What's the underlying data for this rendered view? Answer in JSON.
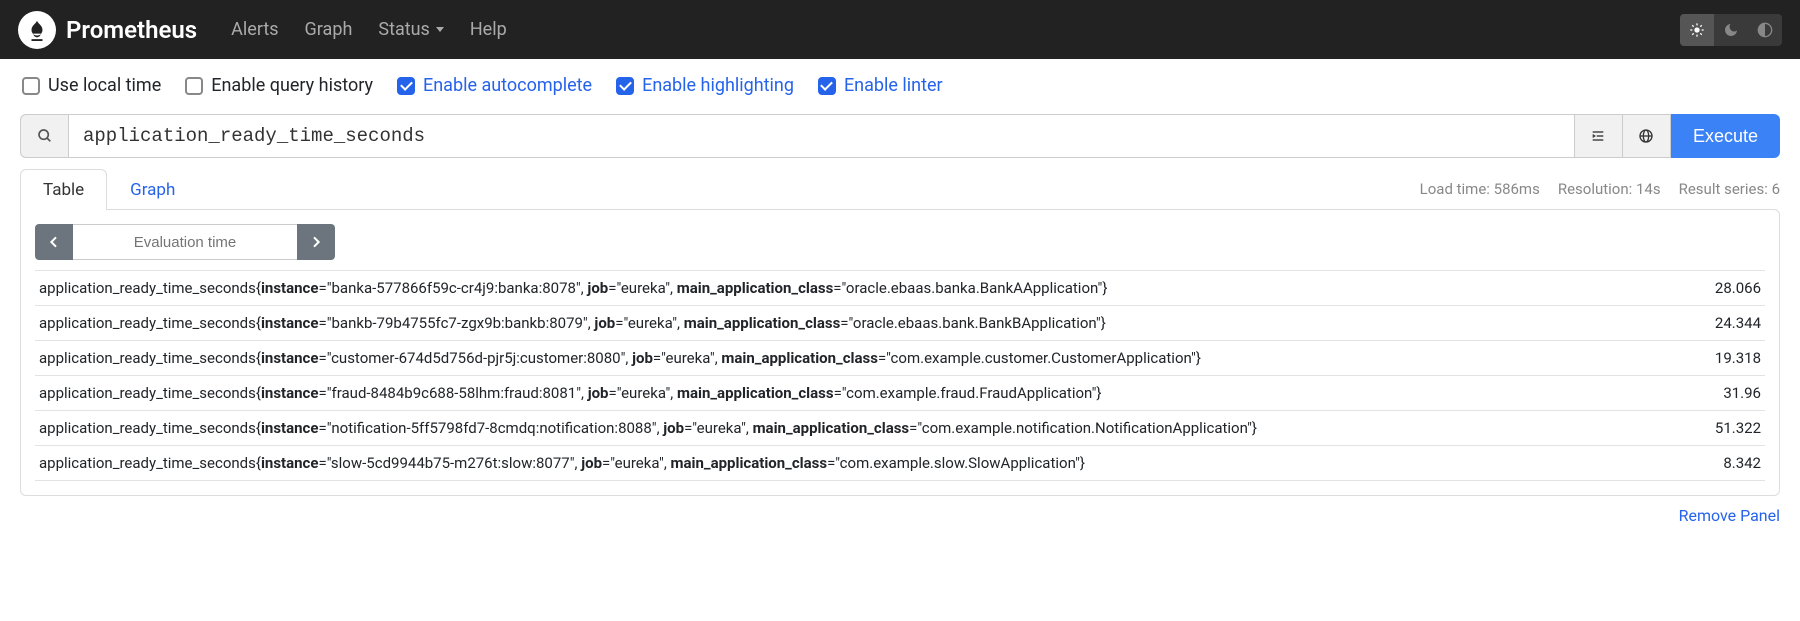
{
  "brand": "Prometheus",
  "nav": {
    "alerts": "Alerts",
    "graph": "Graph",
    "status": "Status",
    "help": "Help"
  },
  "options": {
    "local_time": "Use local time",
    "query_history": "Enable query history",
    "autocomplete": "Enable autocomplete",
    "highlighting": "Enable highlighting",
    "linter": "Enable linter"
  },
  "query": "application_ready_time_seconds",
  "execute": "Execute",
  "tabs": {
    "table": "Table",
    "graph": "Graph"
  },
  "stats": {
    "load": "Load time: 586ms",
    "resolution": "Resolution: 14s",
    "series": "Result series: 6"
  },
  "eval_placeholder": "Evaluation time",
  "remove": "Remove Panel",
  "results": [
    {
      "metric": "application_ready_time_seconds",
      "instance": "banka-577866f59c-cr4j9:banka:8078",
      "job": "eureka",
      "main_application_class": "oracle.ebaas.banka.BankAApplication",
      "value": "28.066"
    },
    {
      "metric": "application_ready_time_seconds",
      "instance": "bankb-79b4755fc7-zgx9b:bankb:8079",
      "job": "eureka",
      "main_application_class": "oracle.ebaas.bank.BankBApplication",
      "value": "24.344"
    },
    {
      "metric": "application_ready_time_seconds",
      "instance": "customer-674d5d756d-pjr5j:customer:8080",
      "job": "eureka",
      "main_application_class": "com.example.customer.CustomerApplication",
      "value": "19.318"
    },
    {
      "metric": "application_ready_time_seconds",
      "instance": "fraud-8484b9c688-58lhm:fraud:8081",
      "job": "eureka",
      "main_application_class": "com.example.fraud.FraudApplication",
      "value": "31.96"
    },
    {
      "metric": "application_ready_time_seconds",
      "instance": "notification-5ff5798fd7-8cmdq:notification:8088",
      "job": "eureka",
      "main_application_class": "com.example.notification.NotificationApplication",
      "value": "51.322"
    },
    {
      "metric": "application_ready_time_seconds",
      "instance": "slow-5cd9944b75-m276t:slow:8077",
      "job": "eureka",
      "main_application_class": "com.example.slow.SlowApplication",
      "value": "8.342"
    }
  ]
}
